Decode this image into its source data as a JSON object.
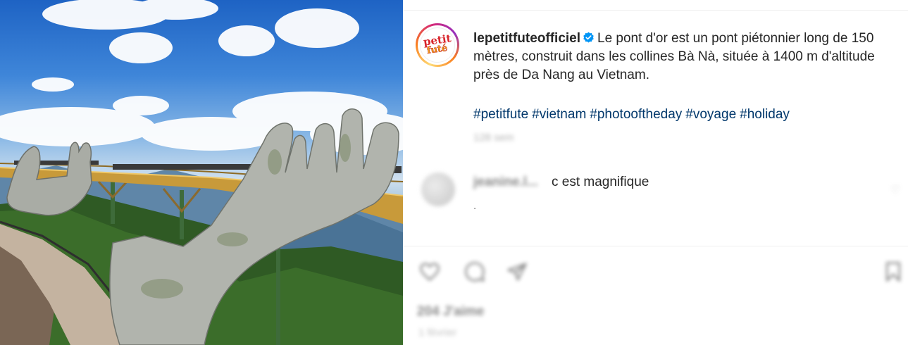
{
  "photo": {
    "description_icon": "golden-bridge-hands-photo"
  },
  "post": {
    "username": "lepetitfuteofficiel",
    "verified_icon": "verified-badge-icon",
    "avatar": {
      "line1": "petit",
      "line2": "futé"
    },
    "caption": "Le pont d'or est un pont piétonnier long de 150 mètres, construit dans les collines Bà Nà, située à 1400 m d'altitude près de Da Nang au Vietnam.",
    "hashtags": [
      "#petitfute",
      "#vietnam",
      "#photooftheday",
      "#voyage",
      "#holiday"
    ],
    "time_ago": "128 sem"
  },
  "comment": {
    "username": "jeanine.l...",
    "text": "c est magnifique",
    "meta": "."
  },
  "actions": {
    "like_icon": "heart-icon",
    "comment_icon": "comment-icon",
    "share_icon": "paper-plane-icon",
    "save_icon": "bookmark-icon"
  },
  "footer": {
    "likes": "204 J'aime",
    "date": "1 février"
  },
  "colors": {
    "hashtag": "#00376b",
    "verified": "#0095f6",
    "text": "#262626",
    "muted": "#737373"
  }
}
